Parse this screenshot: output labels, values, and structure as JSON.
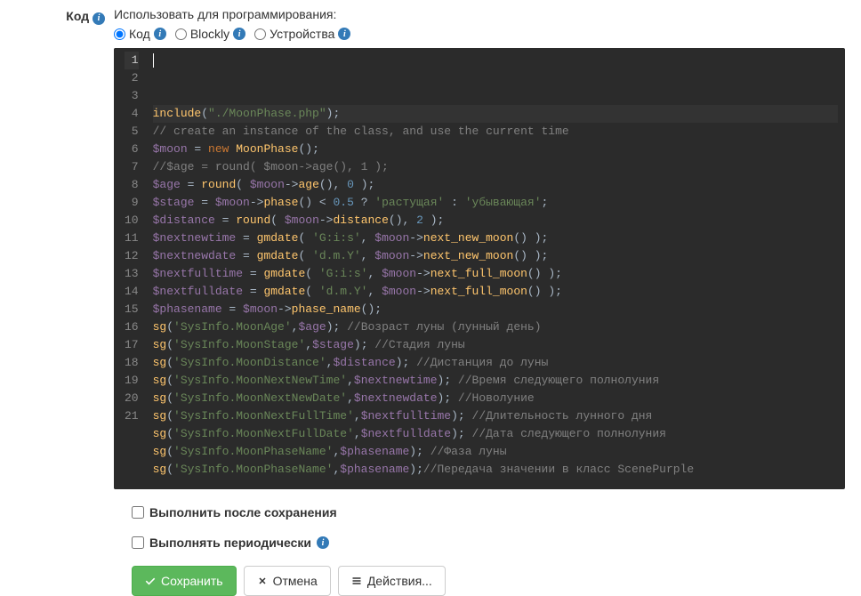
{
  "label": "Код",
  "hint": "Использовать для программирования:",
  "radios": {
    "code": "Код",
    "blockly": "Blockly",
    "devices": "Устройства"
  },
  "code_lines": [
    [
      [
        "fn",
        "include"
      ],
      [
        "op",
        "("
      ],
      [
        "str",
        "\"./MoonPhase.php\""
      ],
      [
        "op",
        ");"
      ]
    ],
    [
      [
        "com",
        "// create an instance of the class, and use the current time"
      ]
    ],
    [
      [
        "var",
        "$moon"
      ],
      [
        "op",
        " = "
      ],
      [
        "kw",
        "new"
      ],
      [
        "op",
        " "
      ],
      [
        "fn",
        "MoonPhase"
      ],
      [
        "op",
        "();"
      ]
    ],
    [
      [
        "com",
        "//$age = round( $moon->age(), 1 );"
      ]
    ],
    [
      [
        "var",
        "$age"
      ],
      [
        "op",
        " = "
      ],
      [
        "fn",
        "round"
      ],
      [
        "op",
        "( "
      ],
      [
        "var",
        "$moon"
      ],
      [
        "op",
        "->"
      ],
      [
        "fn",
        "age"
      ],
      [
        "op",
        "(), "
      ],
      [
        "num",
        "0"
      ],
      [
        "op",
        " );"
      ]
    ],
    [
      [
        "var",
        "$stage"
      ],
      [
        "op",
        " = "
      ],
      [
        "var",
        "$moon"
      ],
      [
        "op",
        "->"
      ],
      [
        "fn",
        "phase"
      ],
      [
        "op",
        "() < "
      ],
      [
        "num",
        "0.5"
      ],
      [
        "op",
        " ? "
      ],
      [
        "str",
        "'растущая'"
      ],
      [
        "op",
        " : "
      ],
      [
        "str",
        "'убывающая'"
      ],
      [
        "op",
        ";"
      ]
    ],
    [
      [
        "var",
        "$distance"
      ],
      [
        "op",
        " = "
      ],
      [
        "fn",
        "round"
      ],
      [
        "op",
        "( "
      ],
      [
        "var",
        "$moon"
      ],
      [
        "op",
        "->"
      ],
      [
        "fn",
        "distance"
      ],
      [
        "op",
        "(), "
      ],
      [
        "num",
        "2"
      ],
      [
        "op",
        " );"
      ]
    ],
    [
      [
        "var",
        "$nextnewtime"
      ],
      [
        "op",
        " = "
      ],
      [
        "fn",
        "gmdate"
      ],
      [
        "op",
        "( "
      ],
      [
        "str",
        "'G:i:s'"
      ],
      [
        "op",
        ", "
      ],
      [
        "var",
        "$moon"
      ],
      [
        "op",
        "->"
      ],
      [
        "fn",
        "next_new_moon"
      ],
      [
        "op",
        "() );"
      ]
    ],
    [
      [
        "var",
        "$nextnewdate"
      ],
      [
        "op",
        " = "
      ],
      [
        "fn",
        "gmdate"
      ],
      [
        "op",
        "( "
      ],
      [
        "str",
        "'d.m.Y'"
      ],
      [
        "op",
        ", "
      ],
      [
        "var",
        "$moon"
      ],
      [
        "op",
        "->"
      ],
      [
        "fn",
        "next_new_moon"
      ],
      [
        "op",
        "() );"
      ]
    ],
    [
      [
        "var",
        "$nextfulltime"
      ],
      [
        "op",
        " = "
      ],
      [
        "fn",
        "gmdate"
      ],
      [
        "op",
        "( "
      ],
      [
        "str",
        "'G:i:s'"
      ],
      [
        "op",
        ", "
      ],
      [
        "var",
        "$moon"
      ],
      [
        "op",
        "->"
      ],
      [
        "fn",
        "next_full_moon"
      ],
      [
        "op",
        "() );"
      ]
    ],
    [
      [
        "var",
        "$nextfulldate"
      ],
      [
        "op",
        " = "
      ],
      [
        "fn",
        "gmdate"
      ],
      [
        "op",
        "( "
      ],
      [
        "str",
        "'d.m.Y'"
      ],
      [
        "op",
        ", "
      ],
      [
        "var",
        "$moon"
      ],
      [
        "op",
        "->"
      ],
      [
        "fn",
        "next_full_moon"
      ],
      [
        "op",
        "() );"
      ]
    ],
    [
      [
        "var",
        "$phasename"
      ],
      [
        "op",
        " = "
      ],
      [
        "var",
        "$moon"
      ],
      [
        "op",
        "->"
      ],
      [
        "fn",
        "phase_name"
      ],
      [
        "op",
        "();"
      ]
    ],
    [
      [
        "fn",
        "sg"
      ],
      [
        "op",
        "("
      ],
      [
        "str",
        "'SysInfo.MoonAge'"
      ],
      [
        "op",
        ","
      ],
      [
        "var",
        "$age"
      ],
      [
        "op",
        "); "
      ],
      [
        "com",
        "//Возраст луны (лунный день)"
      ]
    ],
    [
      [
        "fn",
        "sg"
      ],
      [
        "op",
        "("
      ],
      [
        "str",
        "'SysInfo.MoonStage'"
      ],
      [
        "op",
        ","
      ],
      [
        "var",
        "$stage"
      ],
      [
        "op",
        "); "
      ],
      [
        "com",
        "//Стадия луны"
      ]
    ],
    [
      [
        "fn",
        "sg"
      ],
      [
        "op",
        "("
      ],
      [
        "str",
        "'SysInfo.MoonDistance'"
      ],
      [
        "op",
        ","
      ],
      [
        "var",
        "$distance"
      ],
      [
        "op",
        "); "
      ],
      [
        "com",
        "//Дистанция до луны"
      ]
    ],
    [
      [
        "fn",
        "sg"
      ],
      [
        "op",
        "("
      ],
      [
        "str",
        "'SysInfo.MoonNextNewTime'"
      ],
      [
        "op",
        ","
      ],
      [
        "var",
        "$nextnewtime"
      ],
      [
        "op",
        "); "
      ],
      [
        "com",
        "//Время следующего полнолуния"
      ]
    ],
    [
      [
        "fn",
        "sg"
      ],
      [
        "op",
        "("
      ],
      [
        "str",
        "'SysInfo.MoonNextNewDate'"
      ],
      [
        "op",
        ","
      ],
      [
        "var",
        "$nextnewdate"
      ],
      [
        "op",
        "); "
      ],
      [
        "com",
        "//Новолуние"
      ]
    ],
    [
      [
        "fn",
        "sg"
      ],
      [
        "op",
        "("
      ],
      [
        "str",
        "'SysInfo.MoonNextFullTime'"
      ],
      [
        "op",
        ","
      ],
      [
        "var",
        "$nextfulltime"
      ],
      [
        "op",
        "); "
      ],
      [
        "com",
        "//Длительность лунного дня"
      ]
    ],
    [
      [
        "fn",
        "sg"
      ],
      [
        "op",
        "("
      ],
      [
        "str",
        "'SysInfo.MoonNextFullDate'"
      ],
      [
        "op",
        ","
      ],
      [
        "var",
        "$nextfulldate"
      ],
      [
        "op",
        "); "
      ],
      [
        "com",
        "//Дата следующего полнолуния"
      ]
    ],
    [
      [
        "fn",
        "sg"
      ],
      [
        "op",
        "("
      ],
      [
        "str",
        "'SysInfo.MoonPhaseName'"
      ],
      [
        "op",
        ","
      ],
      [
        "var",
        "$phasename"
      ],
      [
        "op",
        "); "
      ],
      [
        "com",
        "//Фаза луны"
      ]
    ],
    [
      [
        "fn",
        "sg"
      ],
      [
        "op",
        "("
      ],
      [
        "str",
        "'SysInfo.MoonPhaseName'"
      ],
      [
        "op",
        ","
      ],
      [
        "var",
        "$phasename"
      ],
      [
        "op",
        ");"
      ],
      [
        "com",
        "//Передача значении в класс ScenePurple"
      ]
    ]
  ],
  "checks": {
    "run_after_save": "Выполнить после сохранения",
    "run_periodically": "Выполнять периодически"
  },
  "buttons": {
    "save": "Сохранить",
    "cancel": "Отмена",
    "actions": "Действия..."
  }
}
